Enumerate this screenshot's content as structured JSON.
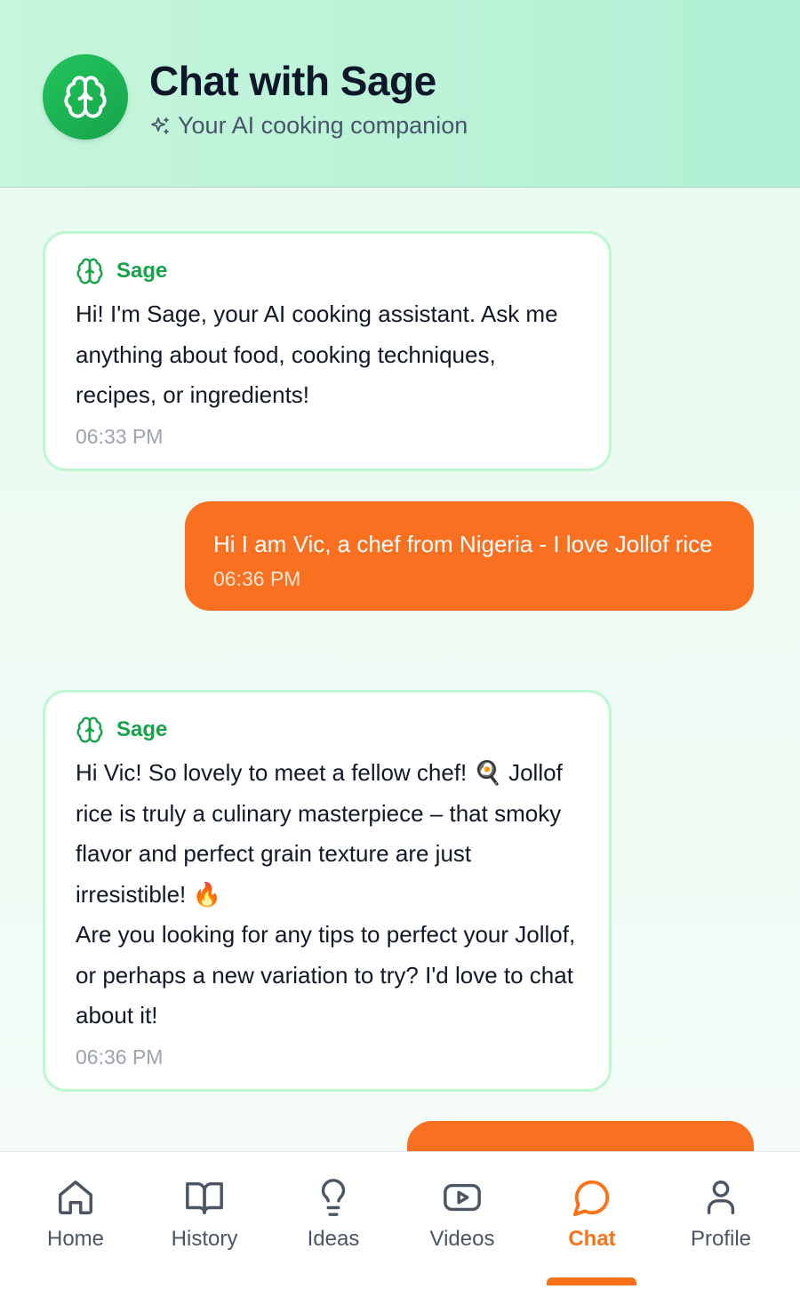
{
  "header": {
    "title": "Chat with Sage",
    "subtitle": "Your AI cooking companion",
    "avatar_icon": "brain-icon",
    "subtitle_icon": "sparkles-icon"
  },
  "messages": [
    {
      "sender": "Sage",
      "role": "assistant",
      "lines": [
        "Hi! I'm Sage, your AI cooking assistant. Ask me anything about food, cooking techniques, recipes, or ingredients!"
      ],
      "time": "06:33 PM"
    },
    {
      "role": "user",
      "lines": [
        "Hi I am Vic, a chef from Nigeria - I love Jollof rice"
      ],
      "time": "06:36 PM"
    },
    {
      "sender": "Sage",
      "role": "assistant",
      "lines": [
        "Hi Vic! So lovely to meet a fellow chef! 🍳 Jollof rice is truly a culinary masterpiece – that smoky flavor and perfect grain texture are just irresistible! 🔥",
        "Are you looking for any tips to perfect your Jollof, or perhaps a new variation to try? I'd love to chat about it!"
      ],
      "time": "06:36 PM"
    }
  ],
  "nav": {
    "items": [
      {
        "label": "Home",
        "icon": "home-icon"
      },
      {
        "label": "History",
        "icon": "book-icon"
      },
      {
        "label": "Ideas",
        "icon": "lightbulb-icon"
      },
      {
        "label": "Videos",
        "icon": "video-icon"
      },
      {
        "label": "Chat",
        "icon": "chat-bubble-icon",
        "active": true
      },
      {
        "label": "Profile",
        "icon": "user-icon"
      }
    ]
  },
  "colors": {
    "accent": "#f97316",
    "user_bubble": "#f97021",
    "assistant_name": "#16a34a",
    "assistant_border": "#bbf7d0"
  }
}
